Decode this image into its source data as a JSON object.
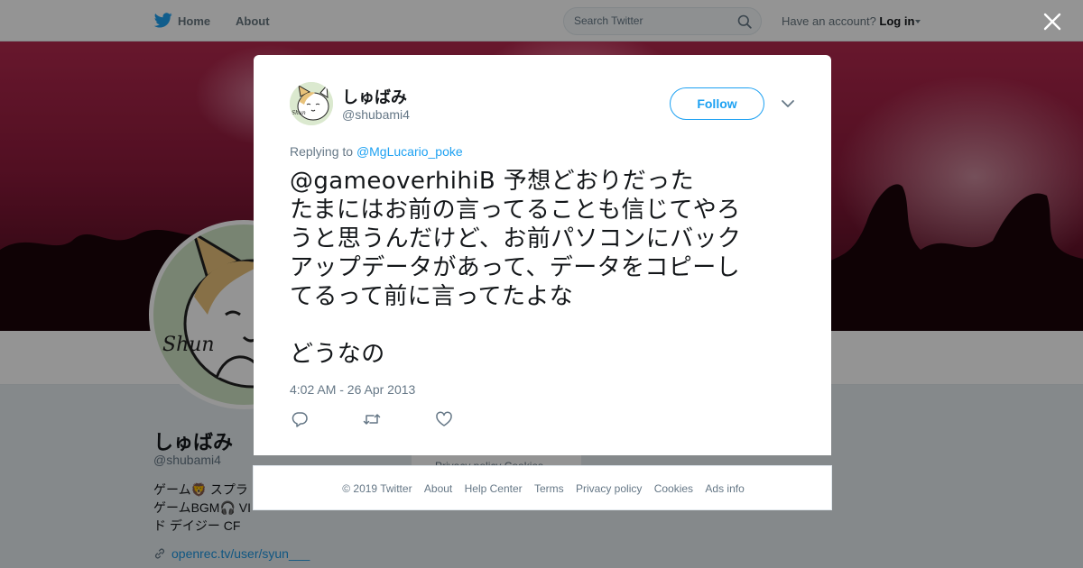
{
  "nav": {
    "home": "Home",
    "about": "About",
    "search_placeholder": "Search Twitter",
    "have_account": "Have an account?",
    "login": "Log in",
    "brand_color": "#1da1f2"
  },
  "profile": {
    "name": "しゅばみ",
    "handle": "@shubami4",
    "bio": "ゲーム🦁 スプラトゥーン ゲームBGM🎧 VI ... ド デイジー CF",
    "bio_lines": [
      "ゲーム🦁 スプラ",
      "ゲームBGM🎧 VI",
      "ド デイジー CF"
    ],
    "link": "openrec.tv/user/syun___",
    "side_footer": "Privacy policy  Cookies"
  },
  "tweet": {
    "name": "しゅばみ",
    "handle": "@shubami4",
    "follow_label": "Follow",
    "replying_prefix": "Replying to",
    "replying_to": "@MgLucario_poke",
    "text_lines": [
      "@gameoverhihiB 予想どおりだった",
      "たまにはお前の言ってることも信じてやろ",
      "うと思うんだけど、お前パソコンにバック",
      "アップデータがあって、データをコピーし",
      "てるって前に言ってたよな",
      "",
      "どうなの"
    ],
    "timestamp": "4:02 AM - 26 Apr 2013",
    "icons": [
      "reply-icon",
      "retweet-icon",
      "like-icon"
    ]
  },
  "footer": {
    "copyright": "© 2019 Twitter",
    "about": "About",
    "help": "Help Center",
    "terms": "Terms",
    "privacy": "Privacy policy",
    "cookies": "Cookies",
    "ads": "Ads info"
  }
}
